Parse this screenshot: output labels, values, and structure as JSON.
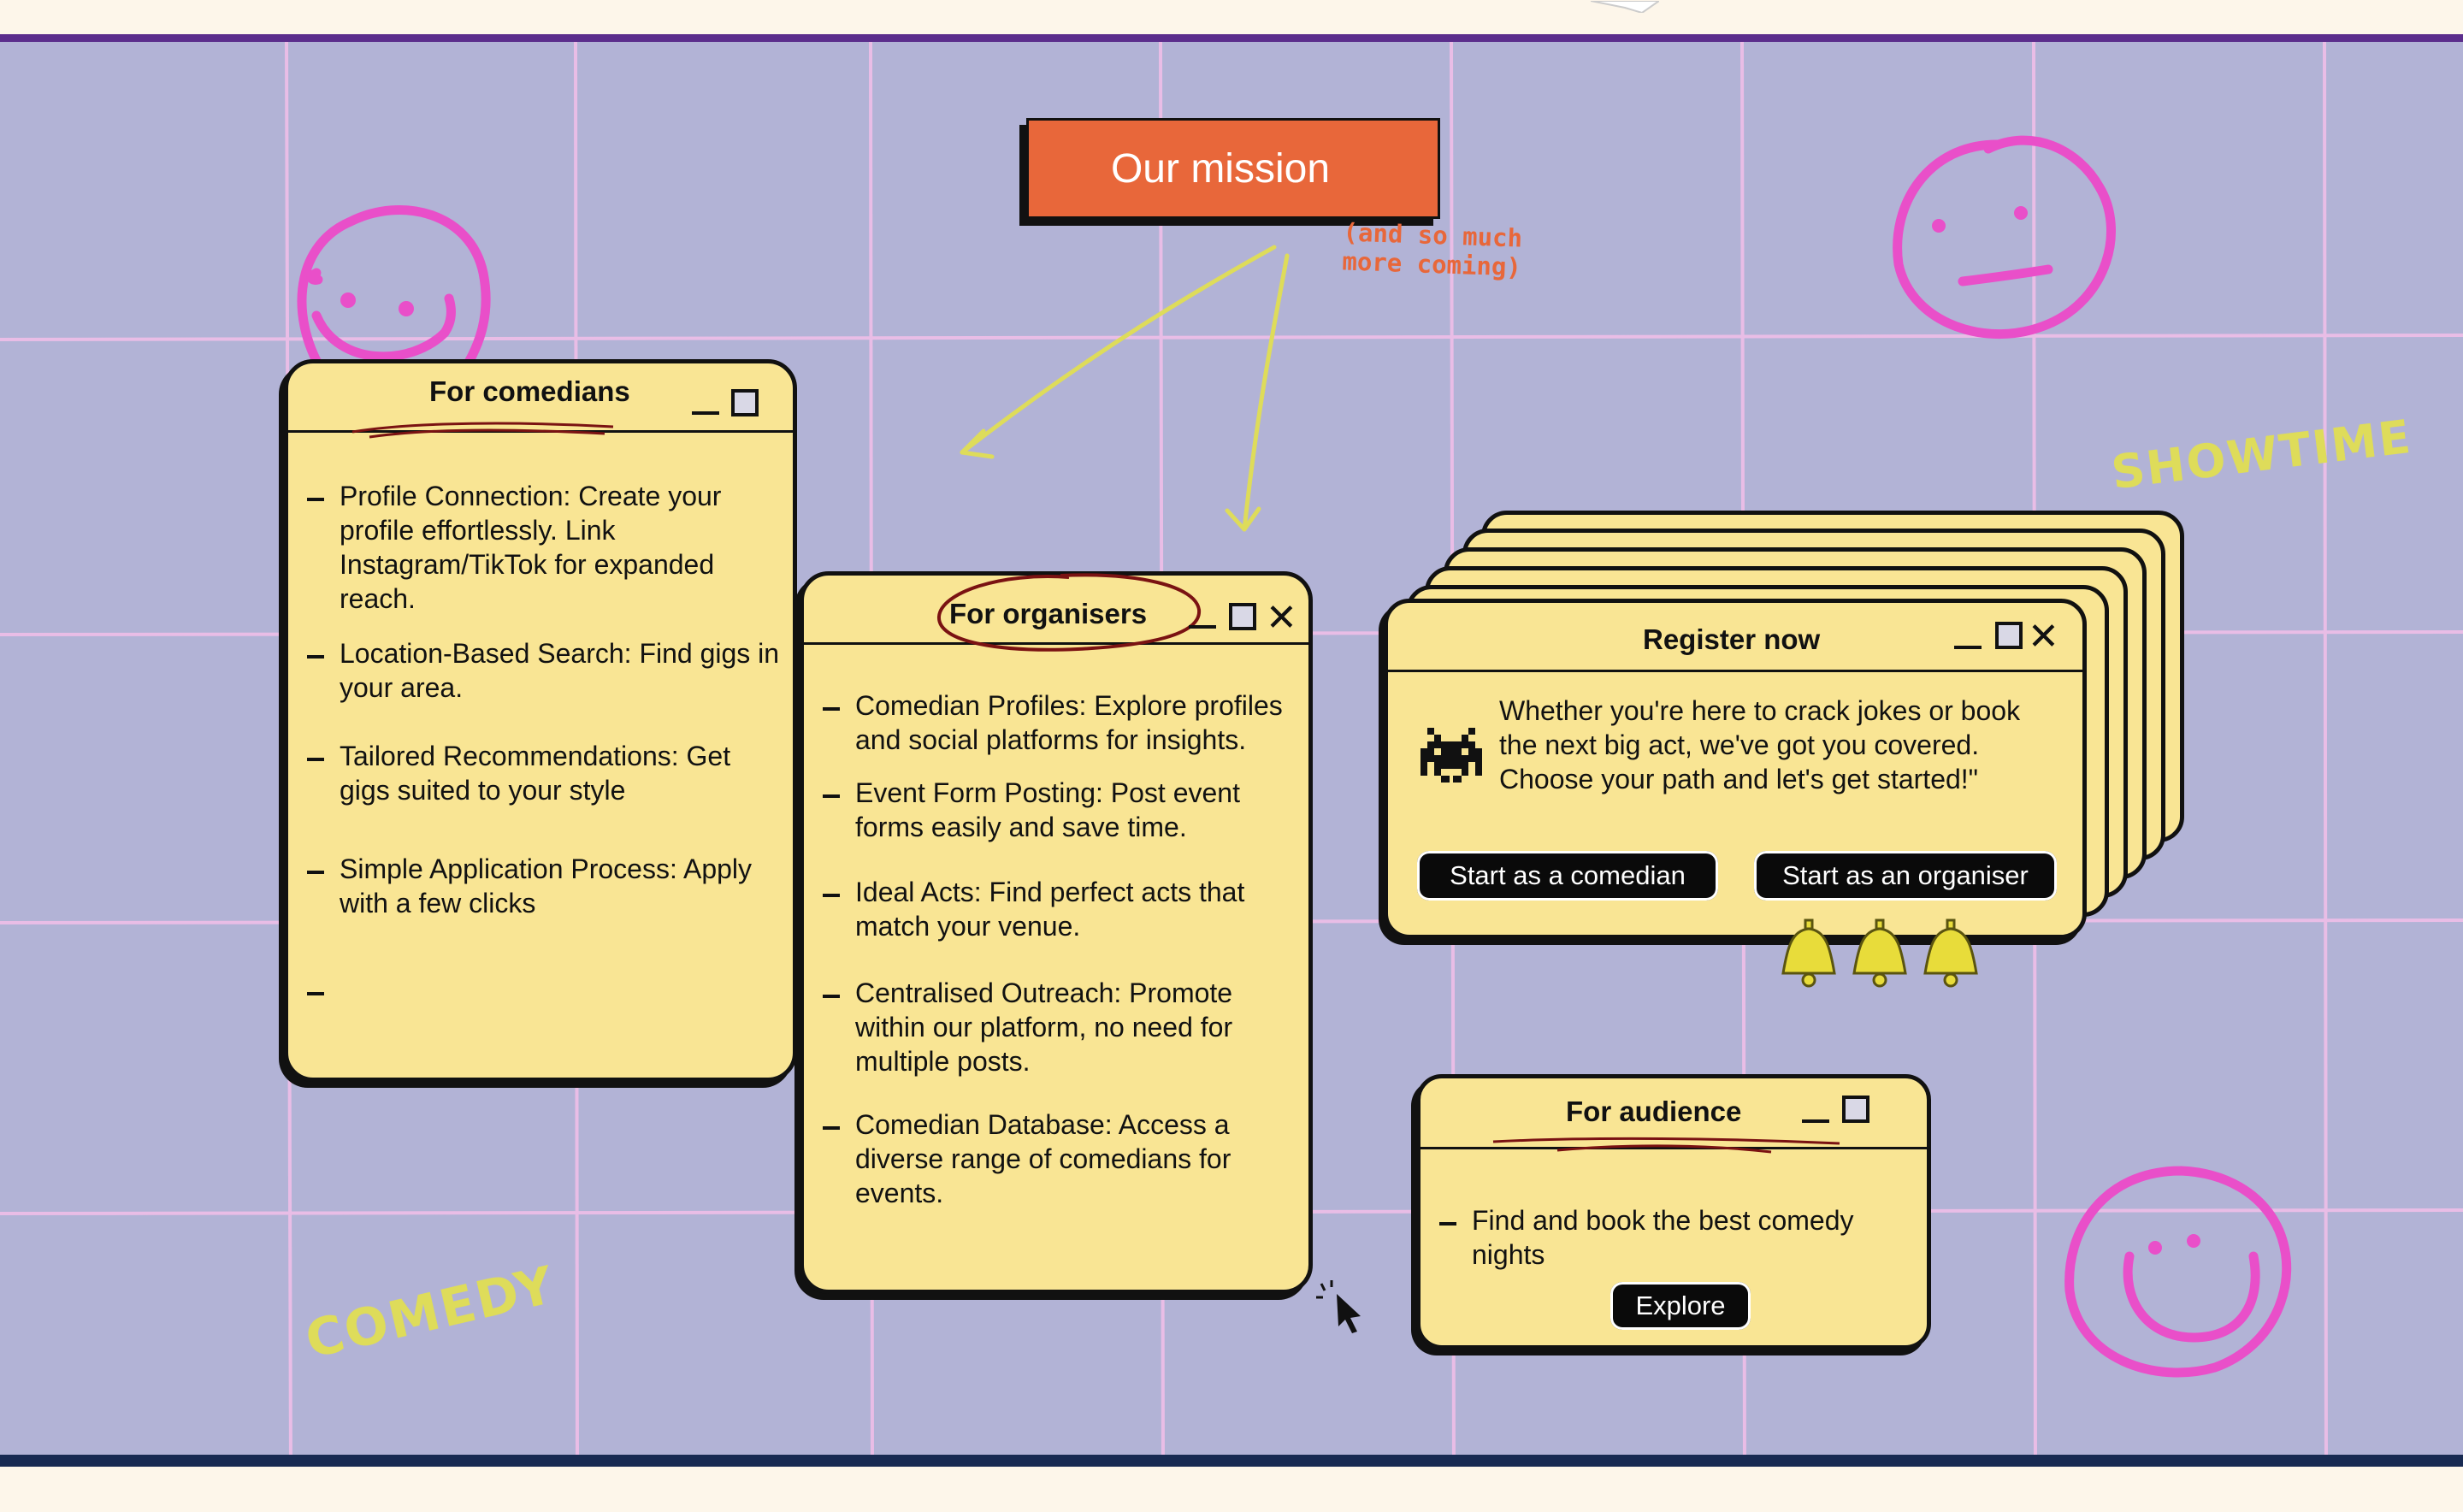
{
  "mission": {
    "button_label": "Our mission",
    "note_line1": "(and so much",
    "note_line2": "more coming)"
  },
  "doodles": {
    "showtime": "SHOWTIME",
    "comedy": "COMEDY"
  },
  "comedians": {
    "title": "For comedians",
    "items": [
      "Profile Connection: Create your profile effortlessly. Link Instagram/TikTok for expanded reach.",
      "Location-Based Search: Find gigs in your area.",
      "Tailored Recommendations: Get gigs suited to your style",
      "Simple Application Process: Apply with a few clicks"
    ]
  },
  "organisers": {
    "title": "For organisers",
    "items": [
      "Comedian Profiles: Explore profiles and social platforms for insights.",
      "Event Form Posting: Post event forms easily and save time.",
      "Ideal Acts: Find perfect acts that match your venue.",
      "Centralised Outreach: Promote within our platform, no need for multiple posts.",
      "Comedian Database: Access a diverse range of comedians for events."
    ]
  },
  "register": {
    "title": "Register now",
    "body": "Whether you're here to crack jokes or book the next big act, we've got you covered. Choose your path and let's get started!\"",
    "comedian_button": "Start as a comedian",
    "organiser_button": "Start as an organiser"
  },
  "audience": {
    "title": "For audience",
    "item": "Find and book the best comedy nights",
    "explore_button": "Explore"
  },
  "colors": {
    "board": "#b2b3d6",
    "grid": "#e9bde6",
    "window": "#f9e594",
    "accent": "#e8673a",
    "smiley": "#e94fc9",
    "doodle_text": "#dedc5a",
    "top_border": "#5b2d8c",
    "bottom_border": "#182a52"
  }
}
